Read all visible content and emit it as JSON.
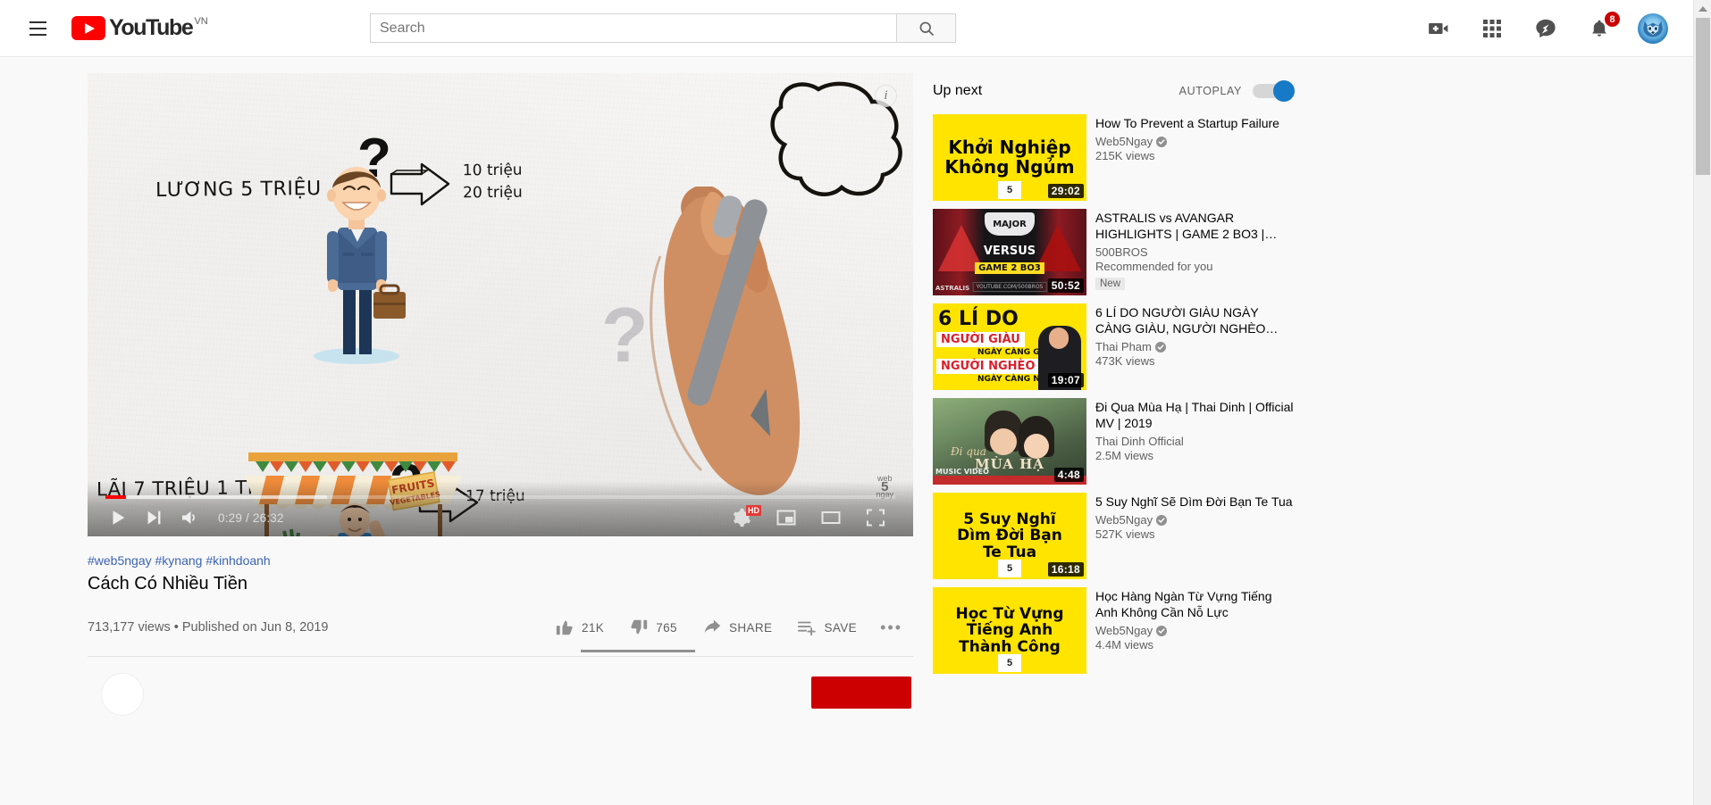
{
  "header": {
    "menu_icon": "hamburger-menu-icon",
    "logo_text": "YouTube",
    "logo_country": "VN",
    "search": {
      "placeholder": "Search",
      "value": "",
      "icon": "search-icon"
    },
    "icons": [
      {
        "name": "create-video-icon",
        "label": "Create"
      },
      {
        "name": "apps-grid-icon",
        "label": "YouTube apps"
      },
      {
        "name": "messages-icon",
        "label": "Messages"
      },
      {
        "name": "notifications-bell-icon",
        "label": "Notifications",
        "badge": "8"
      }
    ],
    "avatar": {
      "name": "account-avatar",
      "alt": "wolf avatar"
    }
  },
  "player": {
    "info_icon": "info-icon",
    "time_current": "0:29",
    "time_total": "26:32",
    "time_display": "0:29 / 26:32",
    "progress_percent": 2.6,
    "buffered_percent": 28,
    "controls": {
      "play": "play-button",
      "next": "next-video-button",
      "volume": "volume-button",
      "settings": "settings-gear-button",
      "quality_badge": "HD",
      "miniplayer": "miniplayer-button",
      "theater": "theater-mode-button",
      "fullscreen": "fullscreen-button"
    },
    "scene": {
      "salary_label": "LƯƠNG 5 TRIỆU",
      "result_1_line1": "10 triệu",
      "result_1_line2": "20 triệu",
      "profit_label": "LÃI 7 TRIỆU 1 THÁNG",
      "result_2": "17 triệu",
      "question_mark": "?",
      "watermark_main": "5",
      "watermark_top": "web",
      "watermark_bottom": "ngay",
      "stall_sign_line1": "FRUITS",
      "stall_sign_line2": "VEGETABLES"
    }
  },
  "video": {
    "hashtags": "#web5ngay #kynang #kinhdoanh",
    "title": "Cách Có Nhiều Tiền",
    "views": "713,177 views",
    "separator": "•",
    "published": "Published on Jun 8, 2019",
    "meta_line": "713,177 views • Published on Jun 8, 2019",
    "actions": {
      "like_count": "21K",
      "dislike_count": "765",
      "share_label": "SHARE",
      "save_label": "SAVE",
      "more_label": "•••"
    }
  },
  "sidebar": {
    "title": "Up next",
    "autoplay_label": "AUTOPLAY",
    "autoplay_on": true,
    "items": [
      {
        "title": "How To Prevent a Startup Failure",
        "channel": "Web5Ngay",
        "verified": true,
        "views": "215K views",
        "duration": "29:02",
        "thumb_style": "yellow",
        "thumb_lines": [
          "Khởi Nghiệp",
          "Không Ngủm"
        ],
        "thumb_font_size": 20
      },
      {
        "title": "ASTRALIS vs AVANGAR HIGHLIGHTS | GAME 2 BO3 |…",
        "channel": "500BROS",
        "verified": false,
        "recommended": "Recommended for you",
        "badge": "New",
        "duration": "50:52",
        "thumb_style": "esports",
        "thumb_lines": [
          "MAJOR",
          "VERSUS",
          "GAME 2 BO3"
        ],
        "thumb_left_label": "ASTRALIS",
        "thumb_url_label": "YOUTUBE.COM/500BROS"
      },
      {
        "title": "6 LÍ DO NGƯỜI GIÀU NGÀY CÀNG GIÀU, NGƯỜI NGHÈO…",
        "channel": "Thai Pham",
        "verified": true,
        "views": "473K views",
        "duration": "19:07",
        "thumb_style": "sixreasons",
        "thumb_lines": [
          "6 LÍ DO",
          "NGƯỜI GIÀU",
          "NGÀY CÀNG GIÀU",
          "NGƯỜI NGHÈO",
          "NGÀY CÀNG NGHÈO"
        ]
      },
      {
        "title": "Đi Qua Mùa Hạ | Thai Dinh | Official MV | 2019",
        "channel": "Thai Dinh Official",
        "verified": false,
        "views": "2.5M views",
        "duration": "4:48",
        "thumb_style": "mv",
        "thumb_lines": [
          "Đi qua",
          "MÙA HẠ"
        ],
        "thumb_tag": "MUSIC VIDEO"
      },
      {
        "title": "5 Suy Nghĩ Sẽ Dìm Đời Bạn Te Tua",
        "channel": "Web5Ngay",
        "verified": true,
        "views": "527K views",
        "duration": "16:18",
        "thumb_style": "yellow",
        "thumb_lines": [
          "5 Suy Nghĩ",
          "Dìm Đời Bạn",
          "Te Tua"
        ],
        "thumb_font_size": 17
      },
      {
        "title": "Học Hàng Ngàn Từ Vựng Tiếng Anh Không Cần Nỗ Lực",
        "channel": "Web5Ngay",
        "verified": true,
        "views": "4.4M views",
        "duration": "",
        "thumb_style": "yellow",
        "thumb_lines": [
          "Học Từ Vựng",
          "Tiếng Anh",
          "Thành Công"
        ],
        "thumb_font_size": 17
      }
    ]
  },
  "colors": {
    "brand_red": "#ff0000",
    "subscribe_red": "#cc0000",
    "autoplay_blue": "#167ac6",
    "link_blue": "#3a64b5",
    "text_primary": "#030303",
    "text_secondary": "#606060",
    "thumb_yellow": "#ffe400"
  }
}
